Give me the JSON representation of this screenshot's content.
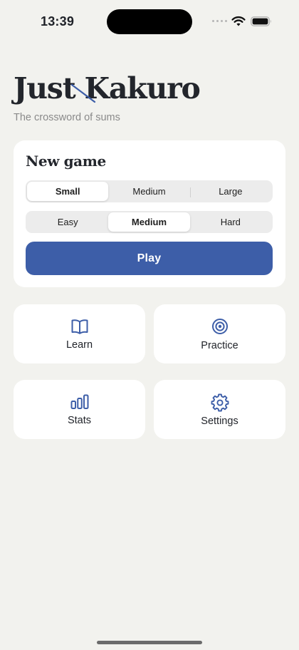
{
  "status_bar": {
    "time": "13:39"
  },
  "header": {
    "title": "Just Kakuro",
    "subtitle": "The crossword of sums"
  },
  "new_game": {
    "title": "New game",
    "sizes": [
      "Small",
      "Medium",
      "Large"
    ],
    "selected_size": "Small",
    "difficulties": [
      "Easy",
      "Medium",
      "Hard"
    ],
    "selected_difficulty": "Medium",
    "play_label": "Play"
  },
  "tiles": [
    {
      "label": "Learn",
      "icon": "book-icon"
    },
    {
      "label": "Practice",
      "icon": "target-icon"
    },
    {
      "label": "Stats",
      "icon": "bar-chart-icon"
    },
    {
      "label": "Settings",
      "icon": "gear-icon"
    }
  ],
  "colors": {
    "accent": "#3d5ea8",
    "background": "#f2f2ee",
    "card": "#ffffff"
  }
}
